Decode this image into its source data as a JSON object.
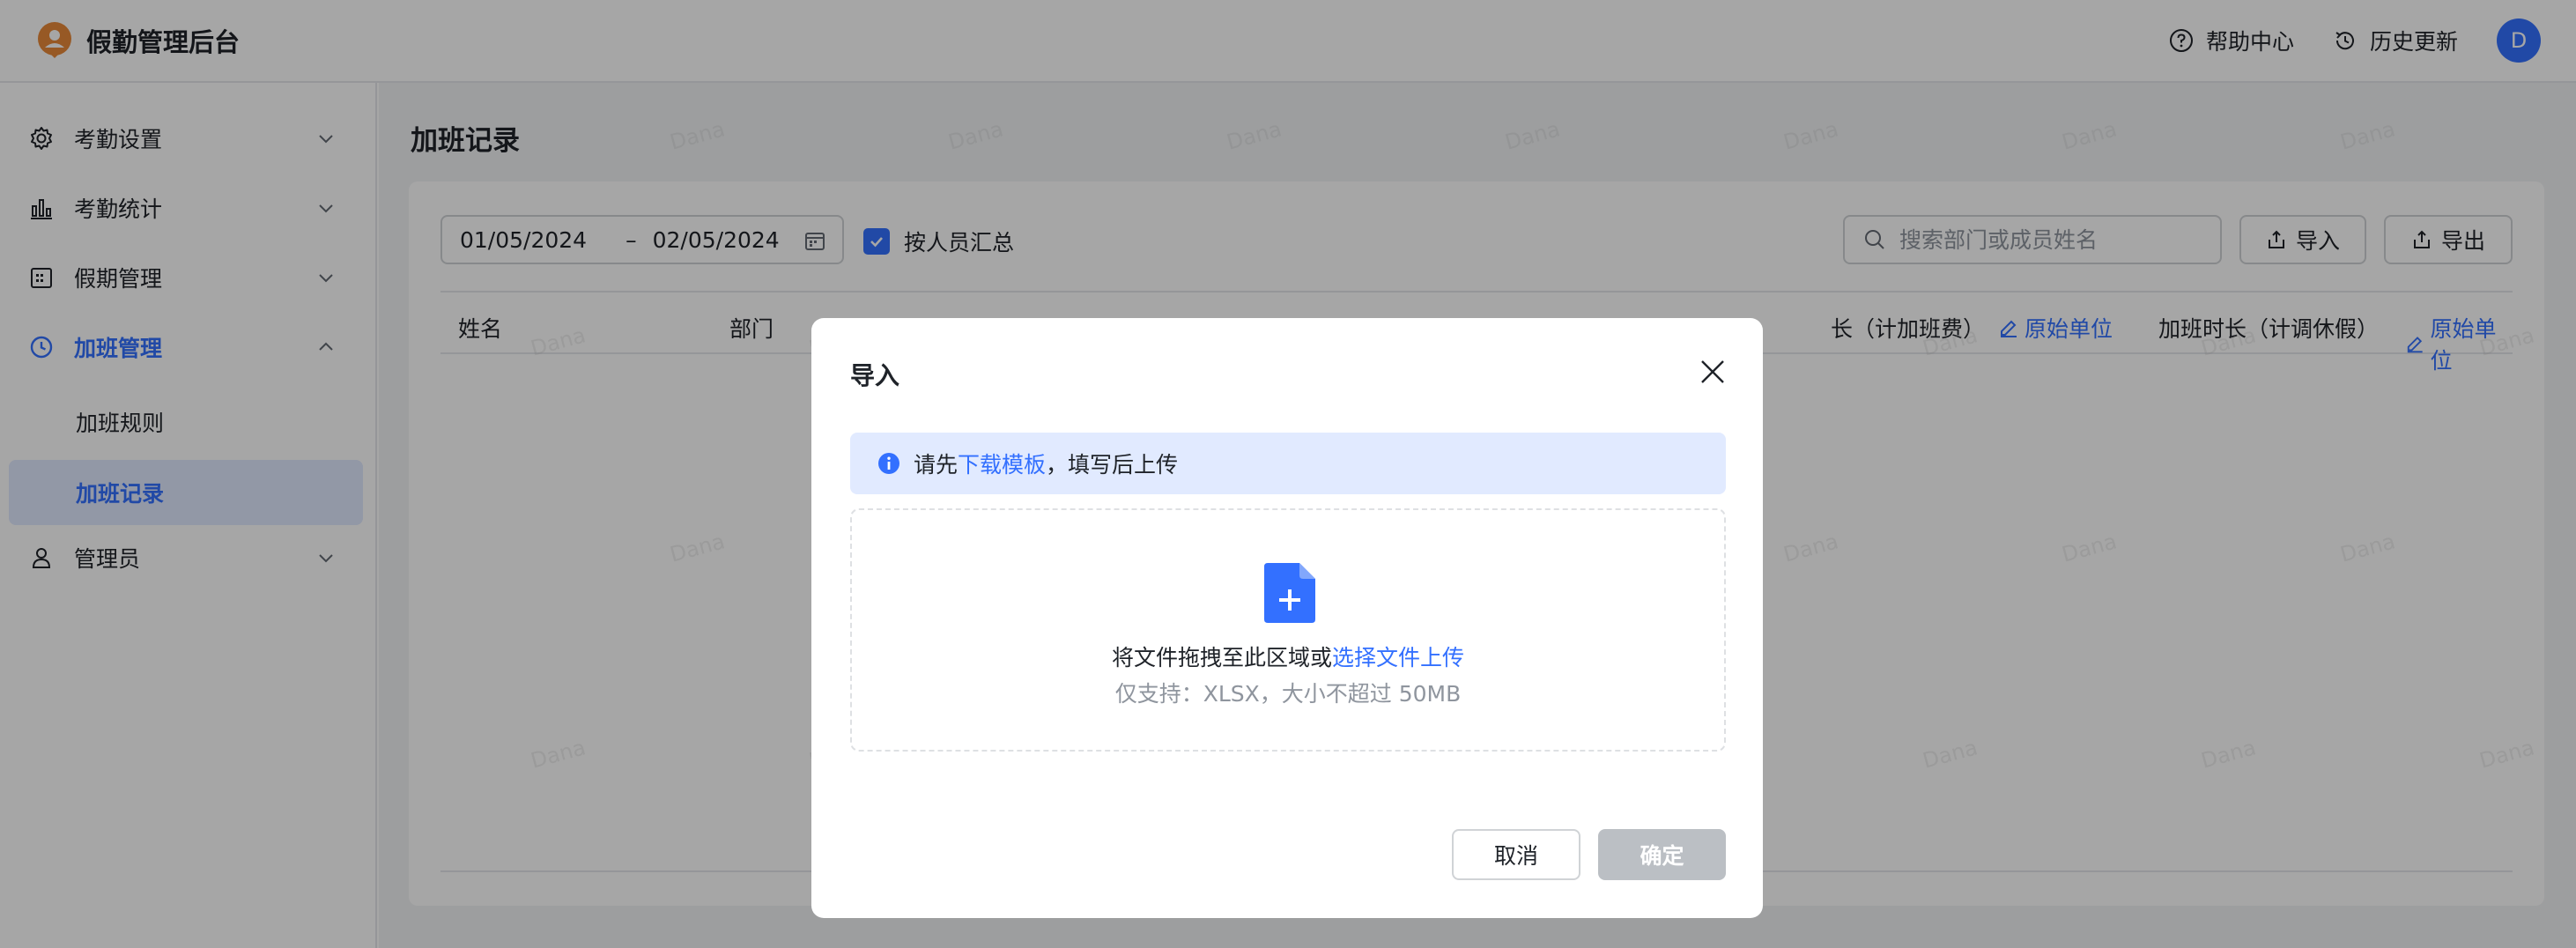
{
  "header": {
    "app_title": "假勤管理后台",
    "help_label": "帮助中心",
    "history_label": "历史更新",
    "avatar_initial": "D"
  },
  "sidebar": {
    "items": [
      {
        "label": "考勤设置",
        "icon": "gear-icon",
        "expanded": false
      },
      {
        "label": "考勤统计",
        "icon": "bar-chart-icon",
        "expanded": false
      },
      {
        "label": "假期管理",
        "icon": "calendar-grid-icon",
        "expanded": false
      },
      {
        "label": "加班管理",
        "icon": "clock-icon",
        "expanded": true,
        "active": true
      },
      {
        "label": "管理员",
        "icon": "user-icon",
        "expanded": false
      }
    ],
    "subitems": [
      {
        "label": "加班规则",
        "selected": false
      },
      {
        "label": "加班记录",
        "selected": true
      }
    ]
  },
  "main": {
    "page_title": "加班记录",
    "date_start": "01/05/2024",
    "date_sep": "–",
    "date_end": "02/05/2024",
    "group_by_person_label": "按人员汇总",
    "group_by_person_checked": true,
    "search_placeholder": "搜索部门或成员姓名",
    "import_label": "导入",
    "export_label": "导出",
    "columns": {
      "name": "姓名",
      "dept": "部门",
      "ot_pay_duration": "长（计加班费）",
      "ot_pay_unit": "原始单位",
      "ot_leave_duration": "加班时长（计调休假）",
      "ot_leave_unit": "原始单位"
    }
  },
  "watermark_text": "Dana",
  "modal": {
    "title": "导入",
    "alert_prefix": "请先",
    "alert_link": "下载模板",
    "alert_suffix": "，填写后上传",
    "drop_text": "将文件拖拽至此区域或",
    "drop_link": "选择文件上传",
    "drop_hint": "仅支持：XLSX，大小不超过 50MB",
    "cancel_label": "取消",
    "ok_label": "确定"
  },
  "colors": {
    "accent": "#3370ff",
    "selected_bg": "#e1eaff",
    "disabled_btn": "#bbbfc4"
  }
}
